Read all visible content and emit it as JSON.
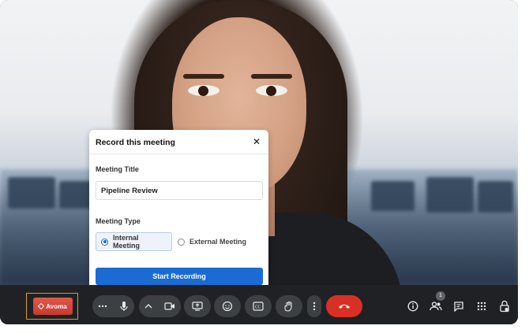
{
  "dialog": {
    "title": "Record this meeting",
    "close_icon": "close-icon",
    "meeting_title_label": "Meeting Title",
    "meeting_title_value": "Pipeline Review",
    "meeting_type_label": "Meeting Type",
    "options": [
      {
        "label": "Internal Meeting",
        "selected": true
      },
      {
        "label": "External Meeting",
        "selected": false
      }
    ],
    "start_button": "Start Recording",
    "accent_color": "#1a6bd4"
  },
  "toolbar": {
    "avoma_label": "Avoma",
    "participants_count": "1",
    "icons": [
      "more-options-icon",
      "microphone-icon",
      "chevron-up-icon",
      "camera-icon",
      "present-screen-icon",
      "emoji-icon",
      "captions-icon",
      "raise-hand-icon",
      "more-vert-icon",
      "end-call-icon",
      "info-icon",
      "people-icon",
      "chat-icon",
      "apps-icon",
      "host-controls-icon"
    ],
    "end_call_color": "#d93025"
  }
}
